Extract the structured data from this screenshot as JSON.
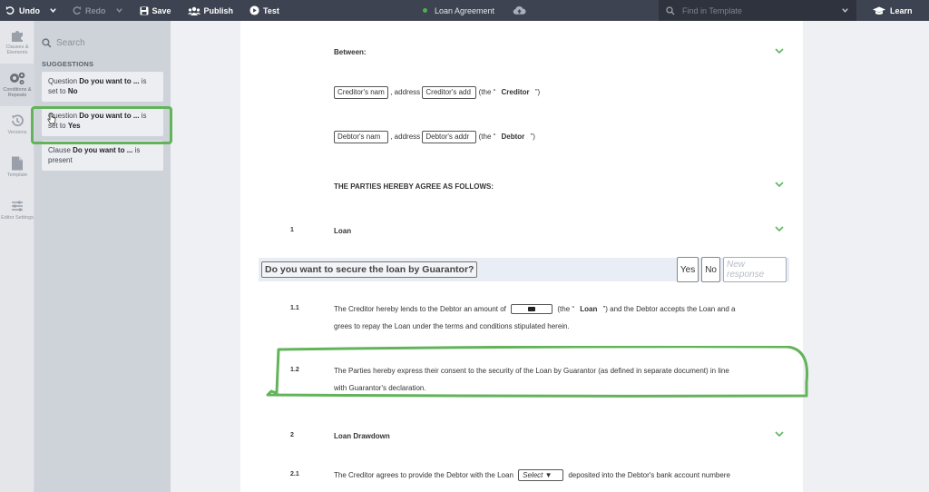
{
  "toolbar": {
    "undo": "Undo",
    "redo": "Redo",
    "save": "Save",
    "publish": "Publish",
    "test": "Test",
    "document_title": "Loan Agreement",
    "search_placeholder": "Find in Template",
    "learn": "Learn"
  },
  "rail": {
    "items": [
      {
        "label": "Clauses & Elements"
      },
      {
        "label": "Conditions & Repeats"
      },
      {
        "label": "Versions"
      },
      {
        "label": "Template"
      },
      {
        "label": "Editor Settings"
      }
    ]
  },
  "panel": {
    "search_label": "Search",
    "title": "SUGGESTIONS",
    "suggestions": [
      {
        "prefix": "Question",
        "bold": "Do you want to ...",
        "mid": "is set to",
        "value": "No"
      },
      {
        "prefix": "Question",
        "bold": "Do you want to ...",
        "mid": "is set to",
        "value": "Yes"
      },
      {
        "prefix": "Clause",
        "bold": "Do you want to ...",
        "mid": "is present",
        "value": ""
      }
    ]
  },
  "document": {
    "between": "Between:",
    "creditor_name": "Creditor's nam",
    "creditor_addr": "Creditor's add",
    "address_word": ", address",
    "the_open": "(the “",
    "the_close": "”)",
    "creditor": "Creditor",
    "debtor_name": "Debtor's nam",
    "debtor_addr": "Debtor's addr",
    "debtor": "Debtor",
    "parties": "THE PARTIES HEREBY AGREE AS FOLLOWS:",
    "sec1_num": "1",
    "sec1_title": "Loan",
    "question": "Do you want to secure the loan by Guarantor?",
    "yes": "Yes",
    "no": "No",
    "new_response": "New response",
    "p11_num": "1.1",
    "p11_a": "The Creditor hereby lends to the Debtor an amount of",
    "p11_b": "(the “",
    "p11_loan": "Loan",
    "p11_c": "”) and the Debtor accepts the Loan and a",
    "p11_d": "grees to repay the Loan under the terms and conditions stipulated herein.",
    "p12_num": "1.2",
    "p12_a": "The Parties hereby express their consent to the security of the Loan by Guarantor (as defined in separate document) in line",
    "p12_b": "with Guarantor's declaration.",
    "sec2_num": "2",
    "sec2_title": "Loan Drawdown",
    "p21_num": "2.1",
    "p21_a": "The Creditor agrees to provide the Debtor with the Loan",
    "p21_select": "Select",
    "p21_b": "deposited into the Debtor's bank account numbere"
  },
  "colors": {
    "topbar": "#3d4350",
    "highlight_green": "#62b35a",
    "chevron_green": "#5cb85c"
  }
}
